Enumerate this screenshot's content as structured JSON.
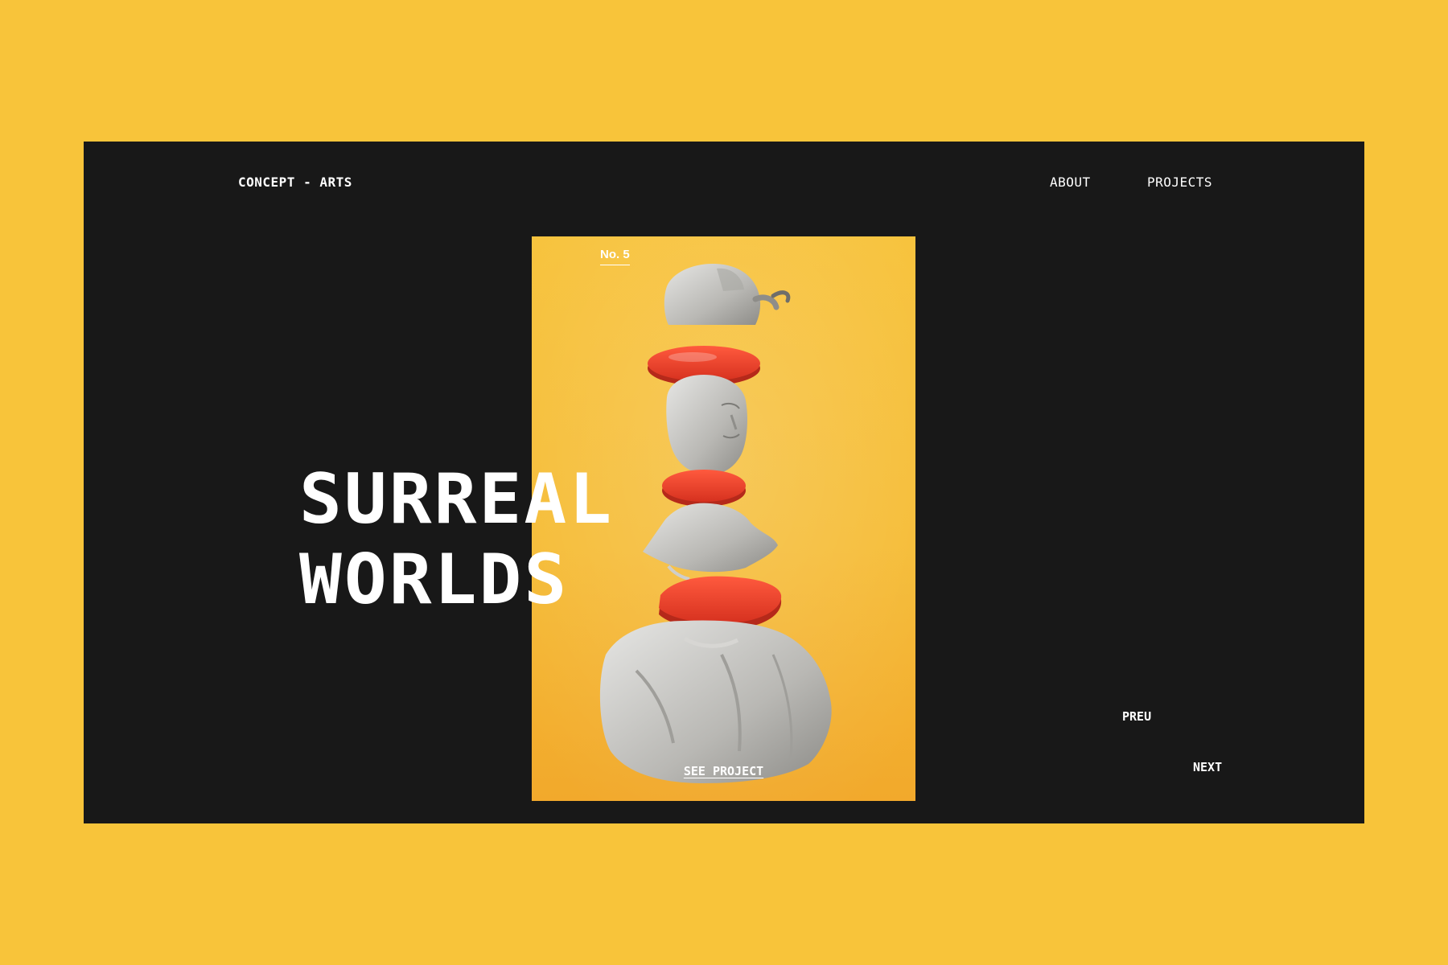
{
  "header": {
    "logo": "CONCEPT - ARTS",
    "nav": {
      "about": "ABOUT",
      "projects": "PROJECTS"
    }
  },
  "poster": {
    "number": "No. 5",
    "cta": "SEE PROJECT"
  },
  "hero": {
    "title_line1": "SURREAL",
    "title_line2": "WORLDS"
  },
  "pager": {
    "prev": "PREU",
    "next": "NEXT"
  },
  "colors": {
    "background": "#f8c43a",
    "screen": "#181818",
    "poster": "#f5bb33",
    "accent_red": "#e8402a",
    "text": "#ffffff"
  }
}
